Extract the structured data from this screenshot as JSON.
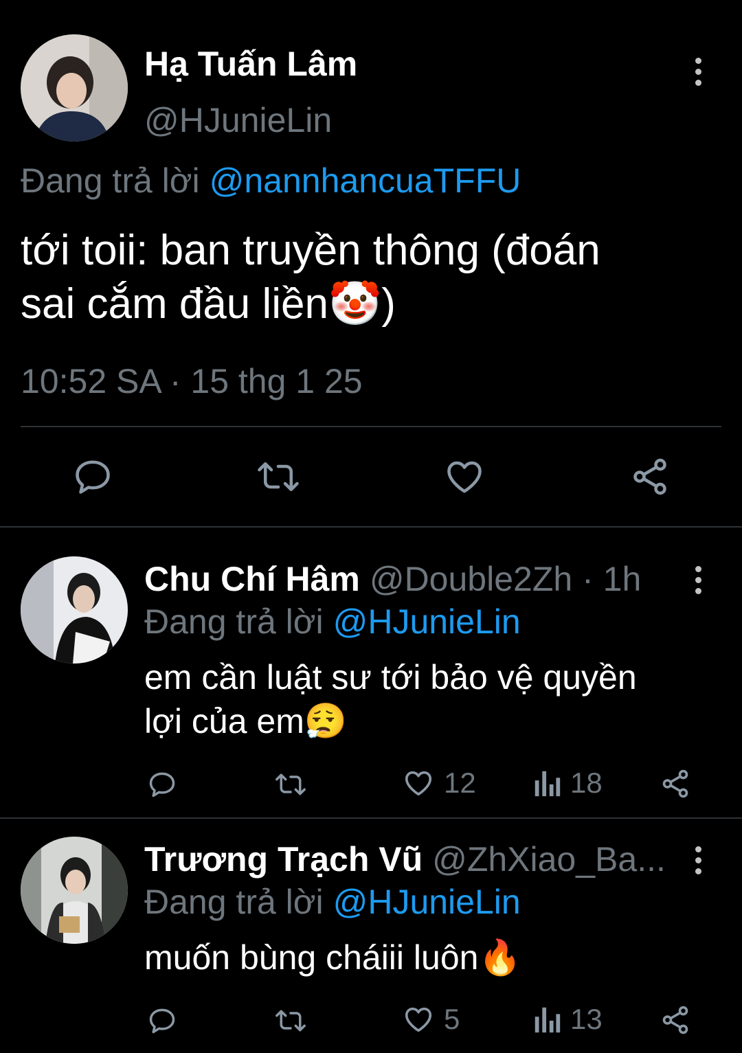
{
  "main_tweet": {
    "display_name": "Hạ Tuấn Lâm",
    "handle": "@HJunieLin",
    "replying_prefix": "Đang trả lời",
    "replying_to": "@nannhancuaTFFU",
    "text_line1": "tới toii: ban truyền thông (đoán",
    "text_line2": "sai cắm đầu liền",
    "text_emoji": "🤡",
    "text_tail": ")",
    "timestamp": "10:52 SA · 15 thg 1 25",
    "actions": [
      "reply-icon",
      "retweet-icon",
      "like-icon",
      "share-icon"
    ]
  },
  "replies": [
    {
      "display_name": "Chu Chí Hâm",
      "handle": "@Double2Zh",
      "time": "· 1h",
      "replying_prefix": "Đang trả lời",
      "replying_to": "@HJunieLin",
      "text_line1": "em cần luật sư tới bảo vệ quyền",
      "text_line2": "lợi của em",
      "emoji": "😮‍💨",
      "likes": "12",
      "views": "18"
    },
    {
      "display_name": "Trương Trạch Vũ",
      "handle": "@ZhXiao_Ba...",
      "replying_prefix": "Đang trả lời",
      "replying_to": "@HJunieLin",
      "text_line1": "muốn bùng cháiii luôn",
      "emoji": "🔥",
      "likes": "5",
      "views": "13"
    }
  ],
  "colors": {
    "background": "#000000",
    "secondary_text": "#6e767d",
    "link_blue": "#1d9bf0",
    "divider": "#2f3336"
  }
}
